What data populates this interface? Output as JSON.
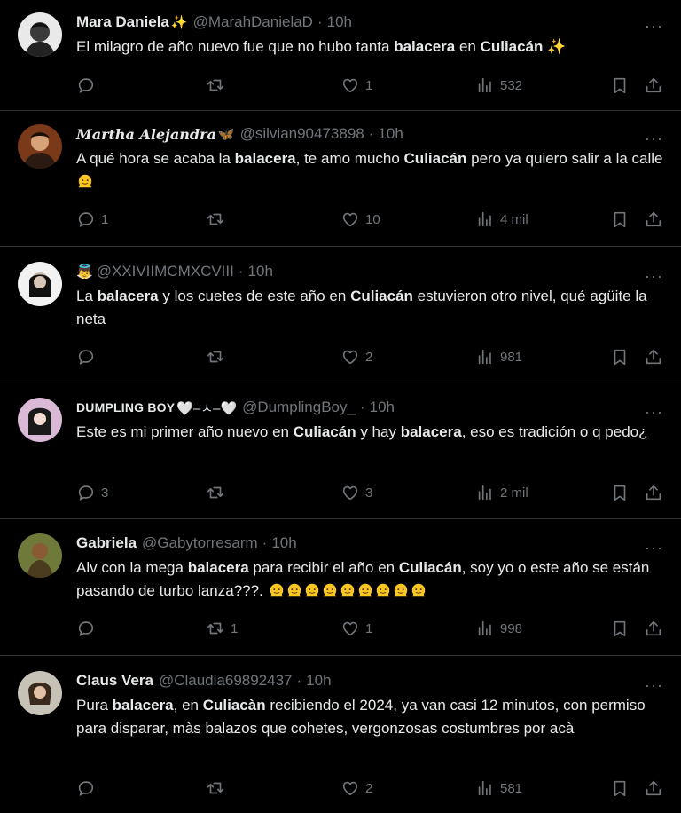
{
  "tweets": [
    {
      "name": "Mara Daniela",
      "name_emoji": "✨",
      "handle": "@MarahDanielaD",
      "time": "10h",
      "text_parts": [
        "El milagro de año nuevo fue que no hubo tanta ",
        "balacera",
        " en ",
        "Culiacán",
        " ✨"
      ],
      "replies": "",
      "retweets": "",
      "likes": "1",
      "views": "532"
    },
    {
      "name": "Martha Alejandra",
      "name_emoji": "🦋",
      "handle": "@silvian90473898",
      "time": "10h",
      "text_parts": [
        "A qué hora se acaba la ",
        "balacera",
        ", te amo mucho ",
        "Culiacán",
        " pero ya quiero salir a la calle"
      ],
      "replies": "1",
      "retweets": "",
      "likes": "10",
      "views": "4 mil"
    },
    {
      "name": "",
      "name_emoji": "👼",
      "handle": "@XXIVIIMCMXCVIII",
      "time": "10h",
      "text_parts": [
        "La ",
        "balacera",
        " y los cuetes de este año en ",
        "Culiacán",
        " estuvieron otro nivel, qué agüite la neta"
      ],
      "replies": "",
      "retweets": "",
      "likes": "2",
      "views": "981"
    },
    {
      "name": "DUMPLING BOY",
      "name_emoji": "🤍–ㅅ–🤍",
      "handle": "@DumplingBoy_",
      "time": "10h",
      "text_parts": [
        "Este es mi primer año nuevo en ",
        "Culiacán",
        " y hay ",
        "balacera",
        ", eso es tradición o q pedo¿"
      ],
      "replies": "3",
      "retweets": "",
      "likes": "3",
      "views": "2 mil"
    },
    {
      "name": "Gabriela",
      "name_emoji": "",
      "handle": "@Gabytorresarm",
      "time": "10h",
      "text_parts": [
        "Alv con la mega ",
        "balacera",
        " para recibir el año en ",
        "Culiacán",
        ", soy yo o este año se están pasando de turbo lanza???. "
      ],
      "replies": "",
      "retweets": "1",
      "likes": "1",
      "views": "998"
    },
    {
      "name": "Claus Vera",
      "name_emoji": "",
      "handle": "@Claudia69892437",
      "time": "10h",
      "text_parts": [
        "Pura ",
        "balacera",
        ", en ",
        "Culiacàn",
        " recibiendo el 2024, ya van casi 12 minutos, con permiso para disparar, màs balazos que cohetes, vergonzosas costumbres por acà"
      ],
      "replies": "",
      "retweets": "",
      "likes": "2",
      "views": "581"
    }
  ],
  "colors": {
    "background": "#000000",
    "text": "#e7e9ea",
    "muted": "#71767b",
    "divider": "#2f3336"
  },
  "icons": [
    "reply-icon",
    "retweet-icon",
    "like-icon",
    "views-icon",
    "bookmark-icon",
    "share-icon",
    "more-icon",
    "melting-face-emoji"
  ]
}
